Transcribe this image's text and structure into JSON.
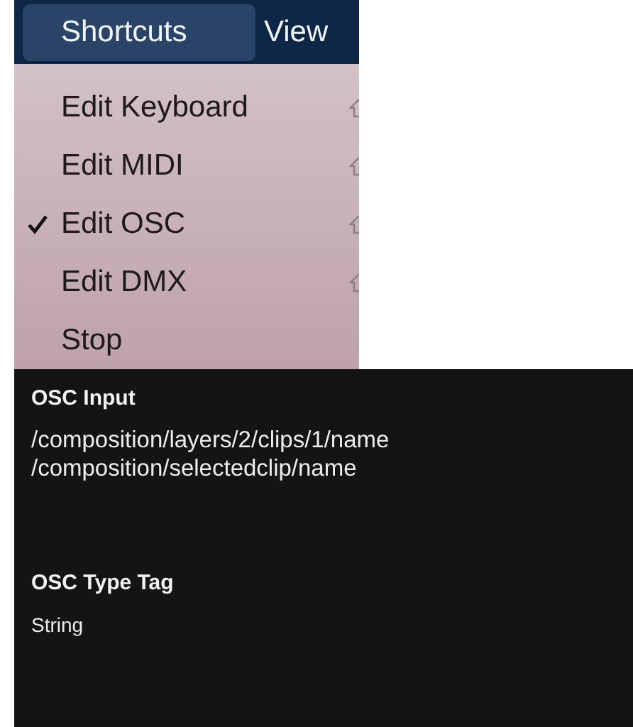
{
  "menu_bar": [
    {
      "label": "Shortcuts",
      "selected": true
    },
    {
      "label": "View",
      "selected": false
    }
  ],
  "menu": [
    {
      "label": "Edit Keyboard",
      "checked": false,
      "shift": true
    },
    {
      "label": "Edit MIDI",
      "checked": false,
      "shift": true
    },
    {
      "label": "Edit OSC",
      "checked": true,
      "shift": true
    },
    {
      "label": "Edit DMX",
      "checked": false,
      "shift": true
    },
    {
      "label": "Stop",
      "checked": false,
      "shift": false
    }
  ],
  "panel": {
    "sections": [
      {
        "title": "OSC Input",
        "lines": [
          "/composition/layers/2/clips/1/name",
          "/composition/selectedclip/name"
        ]
      },
      {
        "title": "OSC Type Tag",
        "lines": [
          "String"
        ]
      }
    ]
  }
}
